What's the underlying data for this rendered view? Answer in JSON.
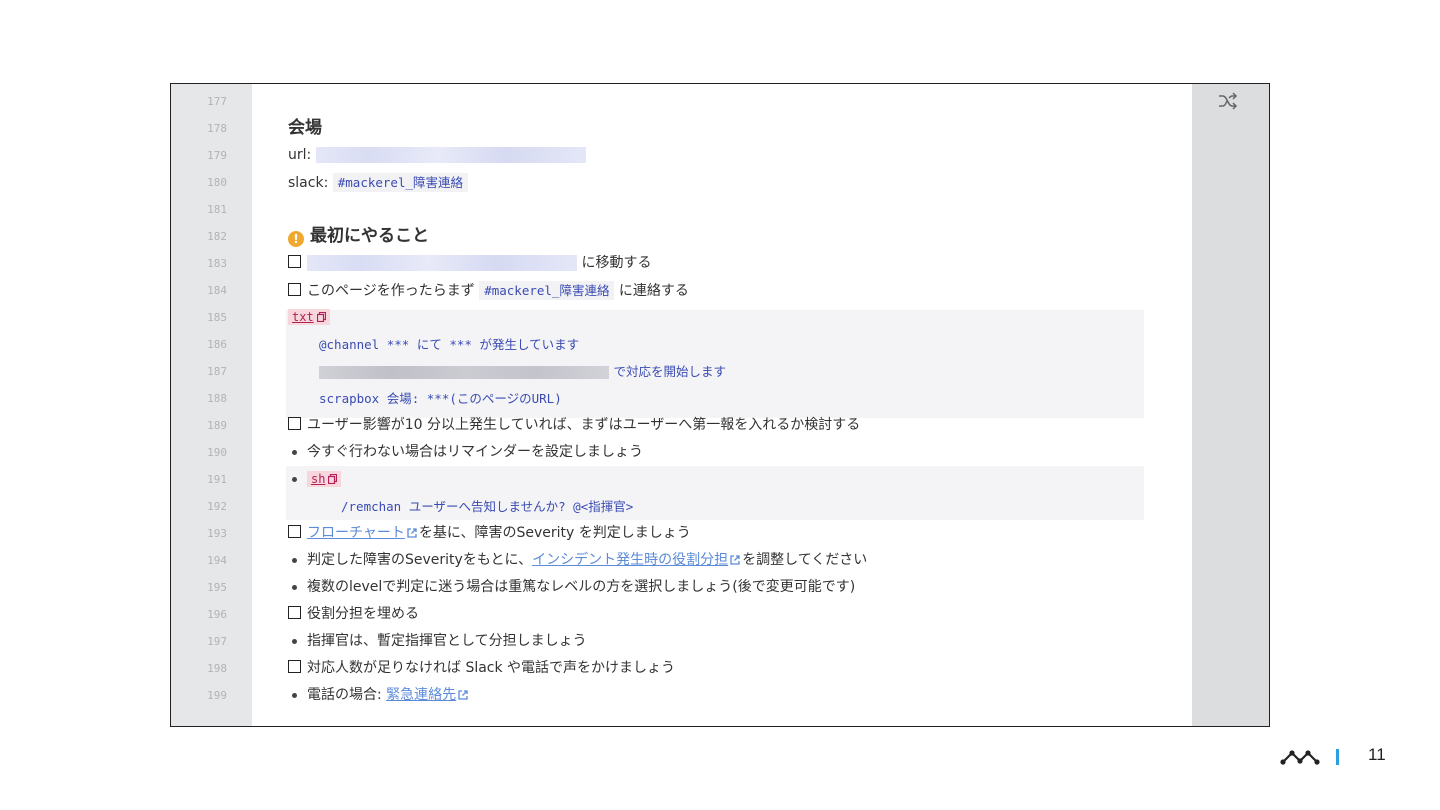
{
  "lines": [
    {
      "n": "177"
    },
    {
      "n": "178"
    },
    {
      "n": "179"
    },
    {
      "n": "180"
    },
    {
      "n": "181"
    },
    {
      "n": "182"
    },
    {
      "n": "183"
    },
    {
      "n": "184"
    },
    {
      "n": "185"
    },
    {
      "n": "186"
    },
    {
      "n": "187"
    },
    {
      "n": "188"
    },
    {
      "n": "189"
    },
    {
      "n": "190"
    },
    {
      "n": "191"
    },
    {
      "n": "192"
    },
    {
      "n": "193"
    },
    {
      "n": "194"
    },
    {
      "n": "195"
    },
    {
      "n": "196"
    },
    {
      "n": "197"
    },
    {
      "n": "198"
    },
    {
      "n": "199"
    }
  ],
  "venue": {
    "heading": "会場",
    "url_label": "url:",
    "slack_label": "slack:",
    "slack_tag": "#mackerel_障害連絡"
  },
  "first_steps": {
    "heading": "最初にやること",
    "warn_icon_glyph": "!",
    "move_text": "に移動する",
    "contact_prefix": "このページを作ったらまず",
    "contact_tag": "#mackerel_障害連絡",
    "contact_suffix": "に連絡する",
    "txt_label": "txt",
    "txt_lines": [
      "@channel *** にて *** が発生しています",
      "で対応を開始します",
      "scrapbox 会場: ***(このページのURL)"
    ],
    "user_impact": "ユーザー影響が10 分以上発生していれば、まずはユーザーへ第一報を入れるか検討する",
    "reminder": "今すぐ行わない場合はリマインダーを設定しましょう",
    "sh_label": "sh",
    "sh_line": "/remchan ユーザーへ告知しませんか? @<指揮官>",
    "flowchart_link": "フローチャート",
    "flowchart_suffix": "を基に、障害のSeverity を判定しましょう",
    "severity_prefix": "判定した障害のSeverityをもとに、",
    "roles_link": "インシデント発生時の役割分担",
    "severity_suffix": "を調整してください",
    "levels": "複数のlevelで判定に迷う場合は重篤なレベルの方を選択しましょう(後で変更可能です)",
    "fill_roles": "役割分担を埋める",
    "commander": "指揮官は、暫定指揮官として分担しましょう",
    "not_enough": "対応人数が足りなければ Slack や電話で声をかけましょう",
    "phone_prefix": "電話の場合: ",
    "emergency_link": "緊急連絡先"
  },
  "footer": {
    "page_number": "11",
    "logo_icon": "mackerel-logo-icon"
  },
  "colors": {
    "link": "#5b8bd9",
    "code": "#3a4bb2",
    "warning": "#f0a92e",
    "accent_bar": "#2d9ee0"
  }
}
